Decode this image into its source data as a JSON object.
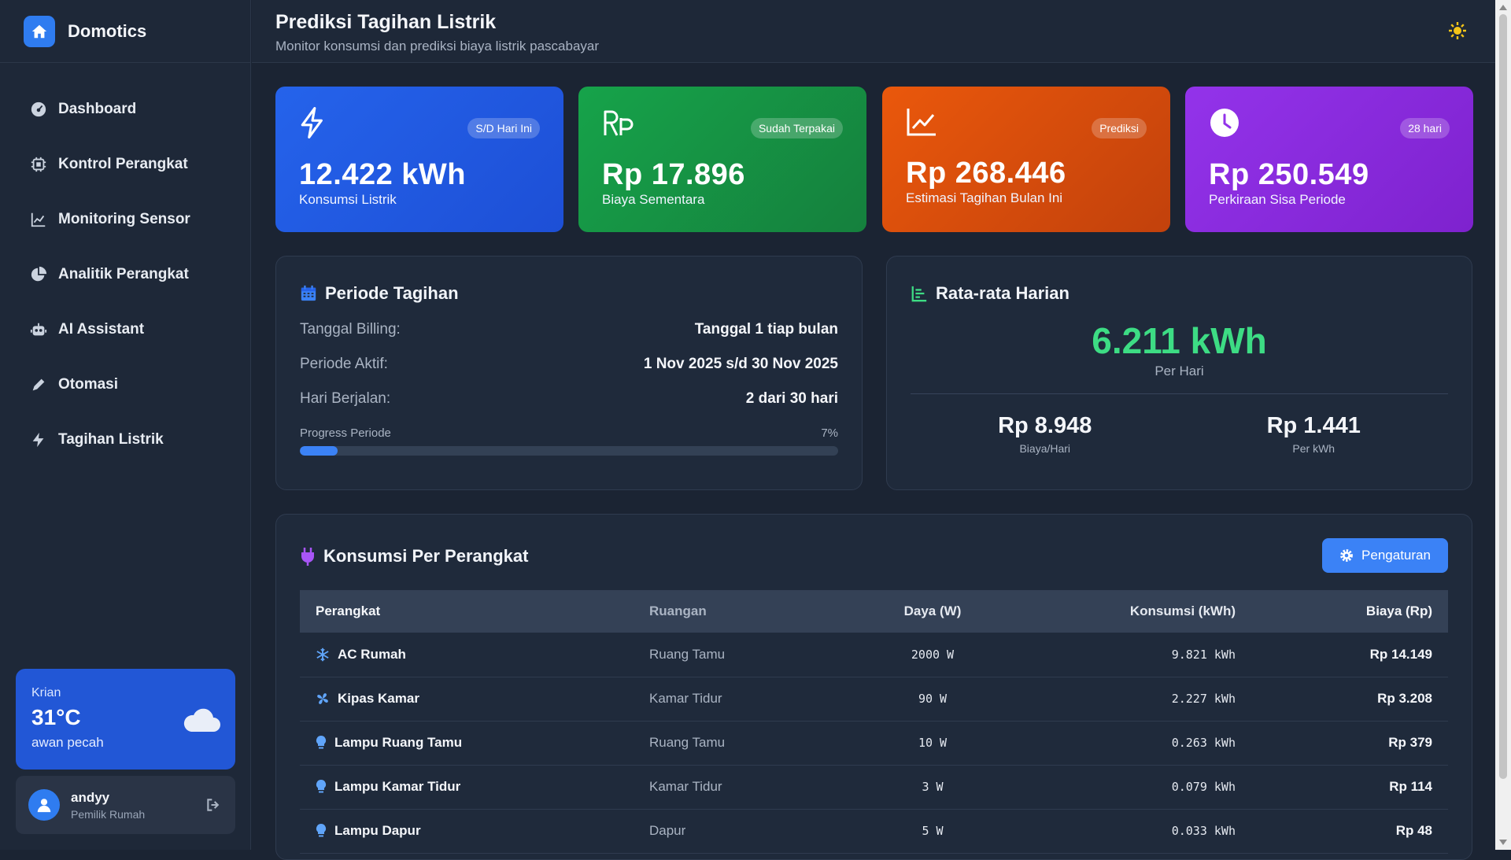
{
  "brand": {
    "name": "Domotics"
  },
  "nav": [
    {
      "label": "Dashboard",
      "icon": "dashboard-icon"
    },
    {
      "label": "Kontrol Perangkat",
      "icon": "chip-icon"
    },
    {
      "label": "Monitoring Sensor",
      "icon": "chart-line-icon"
    },
    {
      "label": "Analitik Perangkat",
      "icon": "pie-chart-icon"
    },
    {
      "label": "AI Assistant",
      "icon": "robot-icon"
    },
    {
      "label": "Otomasi",
      "icon": "pencil-icon"
    },
    {
      "label": "Tagihan Listrik",
      "icon": "bolt-icon"
    }
  ],
  "weather": {
    "city": "Krian",
    "temp": "31°C",
    "desc": "awan pecah"
  },
  "user": {
    "name": "andyy",
    "role": "Pemilik Rumah"
  },
  "header": {
    "title": "Prediksi Tagihan Listrik",
    "subtitle": "Monitor konsumsi dan prediksi biaya listrik pascabayar"
  },
  "stats": [
    {
      "badge": "S/D Hari Ini",
      "value": "12.422 kWh",
      "label": "Konsumsi Listrik",
      "icon": "bolt-icon"
    },
    {
      "badge": "Sudah Terpakai",
      "value": "Rp 17.896",
      "label": "Biaya Sementara",
      "icon": "rupiah-icon"
    },
    {
      "badge": "Prediksi",
      "value": "Rp 268.446",
      "label": "Estimasi Tagihan Bulan Ini",
      "icon": "trend-icon"
    },
    {
      "badge": "28 hari",
      "value": "Rp 250.549",
      "label": "Perkiraan Sisa Periode",
      "icon": "clock-icon"
    }
  ],
  "period": {
    "title": "Periode Tagihan",
    "rows": [
      {
        "key": "Tanggal Billing:",
        "value": "Tanggal 1 tiap bulan"
      },
      {
        "key": "Periode Aktif:",
        "value": "1 Nov 2025 s/d 30 Nov 2025"
      },
      {
        "key": "Hari Berjalan:",
        "value": "2 dari 30 hari"
      }
    ],
    "progress_label": "Progress Periode",
    "progress_text": "7%",
    "progress_value": 0.07
  },
  "daily": {
    "title": "Rata-rata Harian",
    "value": "6.211 kWh",
    "unit_label": "Per Hari",
    "cost_value": "Rp 8.948",
    "cost_label": "Biaya/Hari",
    "rate_value": "Rp 1.441",
    "rate_label": "Per kWh"
  },
  "consumption": {
    "title": "Konsumsi Per Perangkat",
    "settings_label": "Pengaturan",
    "columns": [
      "Perangkat",
      "Ruangan",
      "Daya (W)",
      "Konsumsi (kWh)",
      "Biaya (Rp)"
    ],
    "rows": [
      {
        "device": "AC Rumah",
        "icon": "snowflake-icon",
        "room": "Ruang Tamu",
        "power": "2000 W",
        "kwh": "9.821 kWh",
        "cost": "Rp 14.149"
      },
      {
        "device": "Kipas Kamar",
        "icon": "fan-icon",
        "room": "Kamar Tidur",
        "power": "90 W",
        "kwh": "2.227 kWh",
        "cost": "Rp 3.208"
      },
      {
        "device": "Lampu Ruang Tamu",
        "icon": "bulb-icon",
        "room": "Ruang Tamu",
        "power": "10 W",
        "kwh": "0.263 kWh",
        "cost": "Rp 379"
      },
      {
        "device": "Lampu Kamar Tidur",
        "icon": "bulb-icon",
        "room": "Kamar Tidur",
        "power": "3 W",
        "kwh": "0.079 kWh",
        "cost": "Rp 114"
      },
      {
        "device": "Lampu Dapur",
        "icon": "bulb-icon",
        "room": "Dapur",
        "power": "5 W",
        "kwh": "0.033 kWh",
        "cost": "Rp 48"
      }
    ]
  },
  "colors": {
    "accent": "#3b82f6",
    "success": "#3ddc84",
    "blue_card": "#2563eb",
    "green_card": "#16a34a",
    "orange_card": "#ea580c",
    "purple_card": "#9333ea"
  }
}
